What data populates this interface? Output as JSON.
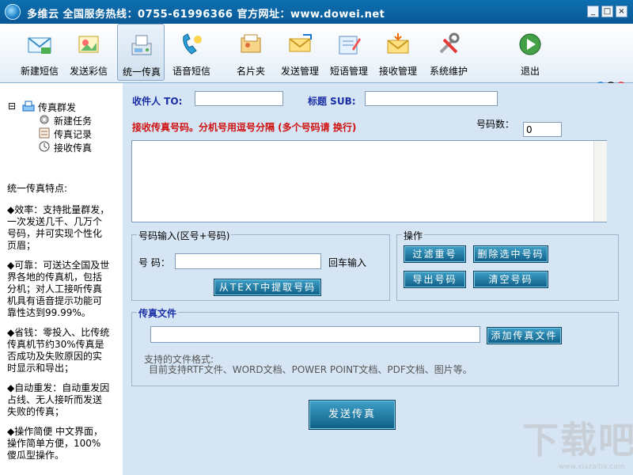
{
  "window": {
    "title": "多维云   全国服务热线：0755-61996366   官方网址：www.dowei.net",
    "min": "_",
    "max": "□",
    "close": "×"
  },
  "toolbar": {
    "items": [
      {
        "label": "新建短信",
        "icon": "new-sms-icon"
      },
      {
        "label": "发送彩信",
        "icon": "send-mms-icon"
      },
      {
        "label": "统一传真",
        "icon": "fax-icon"
      },
      {
        "label": "语音短信",
        "icon": "voice-sms-icon"
      },
      {
        "label": "名片夹",
        "icon": "cardholder-icon"
      },
      {
        "label": "发送管理",
        "icon": "send-manage-icon"
      },
      {
        "label": "短语管理",
        "icon": "phrase-manage-icon"
      },
      {
        "label": "接收管理",
        "icon": "receive-manage-icon"
      },
      {
        "label": "系统维护",
        "icon": "system-maintenance-icon"
      },
      {
        "label": "退出",
        "icon": "exit-icon"
      }
    ]
  },
  "tree": {
    "collapse": "⊟",
    "root": "传真群发",
    "children": [
      "新建任务",
      "传真记录",
      "接收传真"
    ]
  },
  "features": {
    "heading": "统一传真特点:",
    "items": [
      "◆效率：支持批量群发，一次发送几千、几万个号码，并可实现个性化页眉；",
      "◆可靠：可送达全国及世界各地的传真机，包括分机；对人工接听传真机具有语音提示功能可靠性达到99.99%。",
      "◆省钱：零投入、比传统传真机节约30%传真是否成功及失败原因的实时显示和导出；",
      "◆自动重发：自动重发因占线、无人接听而发送失败的传真；",
      "◆操作简便 中文界面，操作简单方便，100%傻瓜型操作。"
    ]
  },
  "form": {
    "recipient_label": "收件人 TO:",
    "recipient_value": "",
    "subject_label": "标题 SUB:",
    "subject_value": "",
    "receive_hint": "接收传真号码。分机号用逗号分隔 (多个号码请 换行)",
    "count_label": "号码数：",
    "count_value": "0",
    "numbers_value": ""
  },
  "number_input": {
    "group_title": "号码输入(区号+号码)",
    "number_label": "号 码：",
    "number_value": "",
    "enter_hint": "回车输入",
    "extract_button": "从TEXT中提取号码"
  },
  "operations": {
    "group_title": "操作",
    "filter_dup": "过滤重号",
    "delete_selected": "删除选中号码",
    "export": "导出号码",
    "clear": "清空号码"
  },
  "fax_file": {
    "group_title": "传真文件",
    "file_value": "",
    "add_button": "添加传真文件",
    "formats_label": "支持的文件格式:",
    "formats_text": "目前支持RTF文件、WORD文档、POWER POINT文档、PDF文档、图片等。"
  },
  "send_button": "发送传真",
  "watermark": {
    "main": "下载吧",
    "sub": "www.xiazaiba.com"
  },
  "colors": {
    "titlebar": "#0d6fb0",
    "button": "#0d5f86",
    "label_blue": "#1a2fa6",
    "label_red": "#d01010"
  }
}
